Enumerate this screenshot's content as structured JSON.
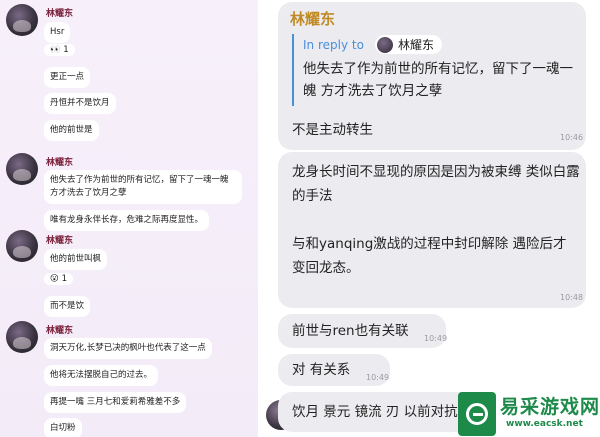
{
  "left_chat": {
    "groups": [
      {
        "sender": "林耀东",
        "messages": [
          "Hsr",
          "更正一点",
          "丹恒并不是饮月",
          "他的前世是"
        ],
        "reaction": {
          "emoji": "👀",
          "count": "1"
        }
      },
      {
        "sender": "林耀东",
        "messages": [
          "他失去了作为前世的所有记忆，留下了一魂一魄 方才洗去了饮月之孽",
          "唯有龙身永伴长存，危难之际再度显性。"
        ]
      },
      {
        "sender": "林耀东",
        "messages": [
          "他的前世叫枫",
          "而不是饮"
        ],
        "reaction": {
          "emoji": "😮",
          "count": "1"
        }
      },
      {
        "sender": "林耀东",
        "messages": [
          "洞天万化,长梦已决的枫叶也代表了这一点",
          "他将无法摆脱自己的过去。",
          "再提一嘴 三月七和爱莉希雅差不多",
          "白切粉"
        ]
      }
    ]
  },
  "right_chat": {
    "sender": "林耀东",
    "reply_label": "In reply to",
    "reply_to_name": "林耀东",
    "reply_quote": "他失去了作为前世的所有记忆，留下了一魂一魄 方才洗去了饮月之孽",
    "messages": [
      {
        "text": "不是主动转生",
        "time": "10:46"
      },
      {
        "text": "龙身长时间不显现的原因是因为被束缚 类似白露的手法\n\n与和yanqing激战的过程中封印解除 遇险后才变回龙态。",
        "time": "10:48"
      },
      {
        "text": "前世与ren也有关联",
        "time": "10:49"
      },
      {
        "text": "对 有关系",
        "time": "10:49"
      },
      {
        "text": "饮月 景元 镜流 刃 以前对抗",
        "time": ""
      }
    ]
  },
  "watermark": {
    "title": "易采游戏网",
    "url": "www.eacsk.net",
    "color": "#1e8a4a"
  }
}
